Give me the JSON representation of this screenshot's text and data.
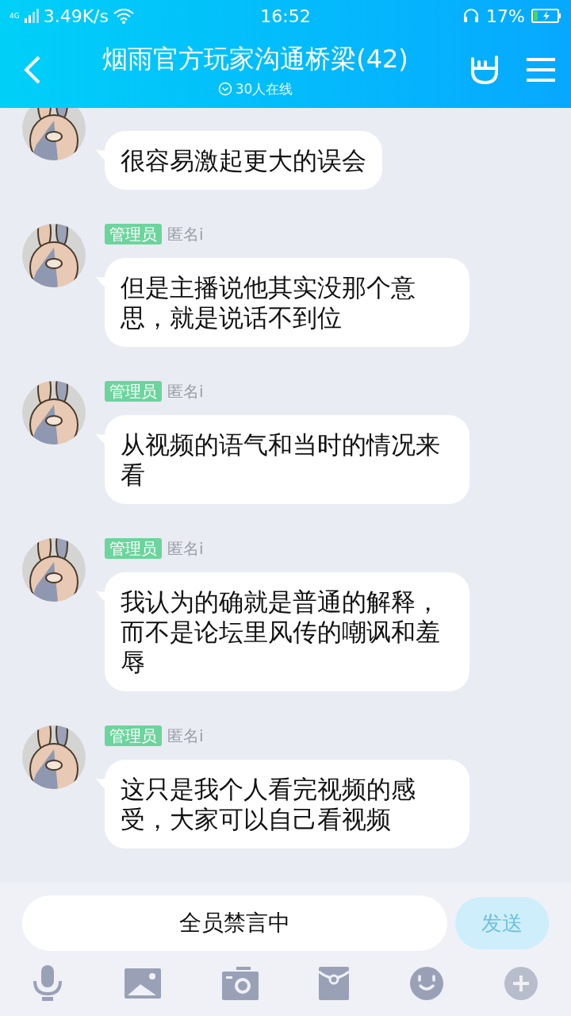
{
  "status_bar": {
    "network": "4G",
    "speed": "3.49K/s",
    "time": "16:52",
    "battery": "17%"
  },
  "header": {
    "title": "烟雨官方玩家沟通桥梁(42)",
    "online": "30人在线"
  },
  "messages": [
    {
      "text": "很容易激起更大的误会"
    },
    {
      "badge": "管理员",
      "name": "匿名i",
      "text": "但是主播说他其实没那个意思，就是说话不到位"
    },
    {
      "badge": "管理员",
      "name": "匿名i",
      "text": "从视频的语气和当时的情况来看"
    },
    {
      "badge": "管理员",
      "name": "匿名i",
      "text": "我认为的确就是普通的解释，而不是论坛里风传的嘲讽和羞辱"
    },
    {
      "badge": "管理员",
      "name": "匿名i",
      "text": "这只是我个人看完视频的感受，大家可以自己看视频"
    }
  ],
  "input": {
    "value": "全员禁言中",
    "send": "发送",
    "send_disabled": true
  }
}
